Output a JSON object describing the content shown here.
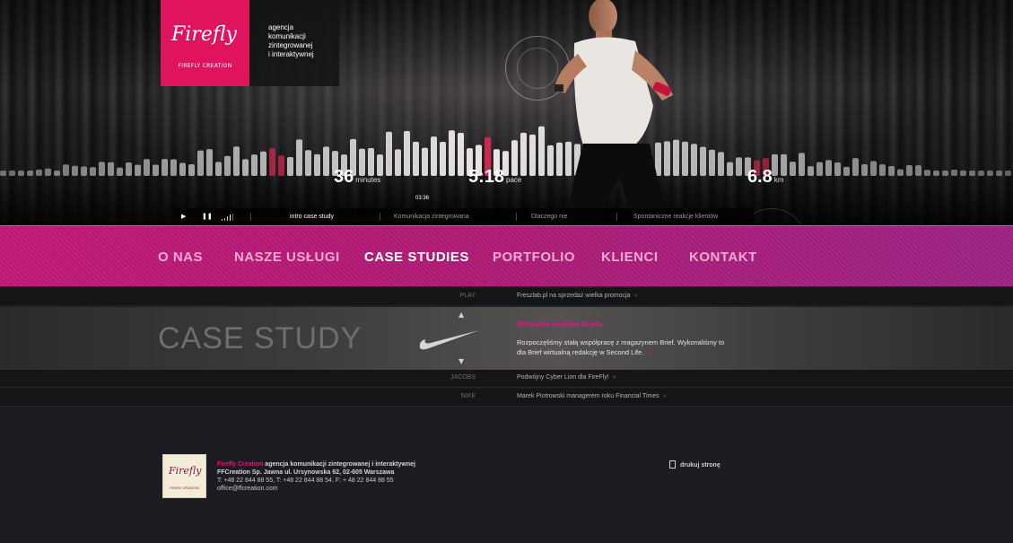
{
  "brand": {
    "logo_script": "Firefly",
    "logo_sub": "FIREFLY CREATION",
    "tagline": [
      "agencja",
      "komunikacji",
      "zintegrowanej",
      "i interaktywnej"
    ]
  },
  "hero": {
    "stats": [
      {
        "value": "36",
        "unit": "minutes"
      },
      {
        "value": "5:18",
        "unit": "pace"
      },
      {
        "value": "6.8",
        "unit": "km"
      }
    ],
    "timecode": "03:36",
    "player": {
      "play_icon": "play-icon",
      "pause_icon": "pause-icon",
      "volume_icon": "volume-icon"
    },
    "segments": [
      {
        "label": "intro case study",
        "active": true
      },
      {
        "label": "Komunikacja zintegrowana",
        "active": false
      },
      {
        "label": "Dlaczego nie",
        "active": false
      },
      {
        "label": "Spontaniczne reakcje klientów",
        "active": false
      }
    ]
  },
  "nav": {
    "items": [
      {
        "label": "O NAS",
        "active": false
      },
      {
        "label": "NASZE USŁUGI",
        "active": false
      },
      {
        "label": "CASE STUDIES",
        "active": true
      },
      {
        "label": "PORTFOLIO",
        "active": false
      },
      {
        "label": "KLIENCI",
        "active": false
      },
      {
        "label": "KONTAKT",
        "active": false
      }
    ]
  },
  "case_study": {
    "heading": "CASE STUDY",
    "rows_above": [
      {
        "brand": "PLAY",
        "title": "Freszlab.pl na sprzedaż wielka promocja",
        "arrow": "»"
      }
    ],
    "feature": {
      "brand_icon": "nike-swoosh-icon",
      "title": "Wirtualna siedziba Briefu",
      "description": "Rozpoczęliśmy stałą współpracę z magazynem Brief. Wykonaliśmy to dla Brief wirtualną redakcję w Second Life.",
      "more": "»",
      "up_icon": "▲",
      "down_icon": "▼"
    },
    "rows_below": [
      {
        "brand": "JACOBS",
        "title": "Podwójny Cyber Lion dla FireFly!",
        "arrow": "»"
      },
      {
        "brand": "NIKE",
        "title": "Marek Piotrowski managerem roku Financial Times",
        "arrow": "»"
      }
    ]
  },
  "footer": {
    "logo_script": "Firefly",
    "logo_sub": "FIREFLY CREATION",
    "company_name": "Firefly Creation",
    "company_desc": " agencja komunikacji zintegrowanej i interaktywnej",
    "address": "FFCreation Sp. Jawna ul. Ursynowska 62, 02-605 Warszawa",
    "phones": "T: +48 22 844 88 55, T: +48 22 844 88 54, F: + 48 22 844 88 55",
    "email": "office@ffcreation.com",
    "print_label": "drukuj stronę",
    "print_icon": "print-icon"
  },
  "colors": {
    "accent": "#e0135f",
    "nav_pink": "#c21977",
    "nav_purple": "#9d2385",
    "background": "#1b1b1f"
  }
}
